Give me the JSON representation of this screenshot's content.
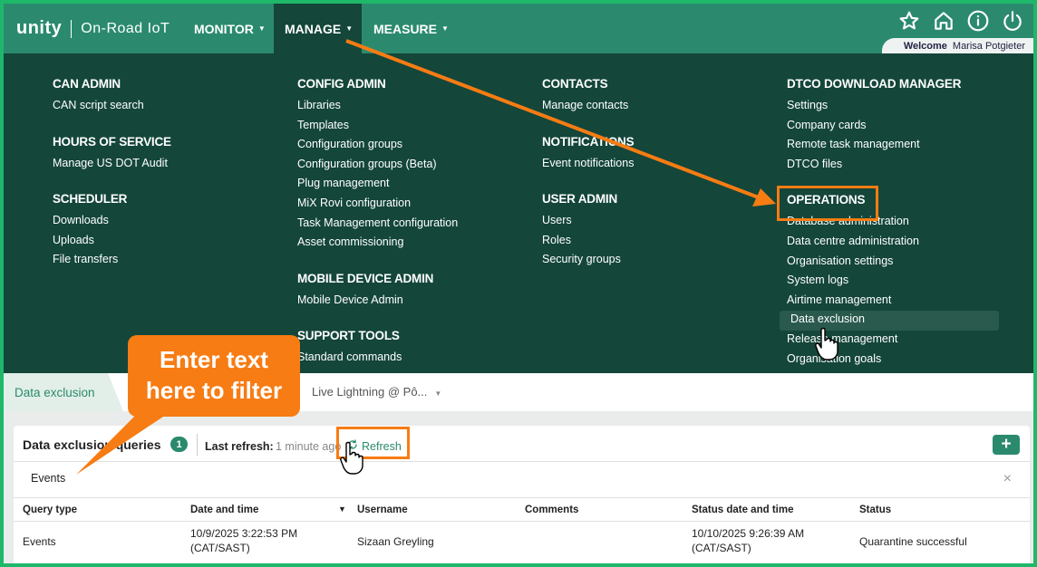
{
  "app": {
    "brand": "unity",
    "product": "On-Road IoT"
  },
  "nav": {
    "items": [
      {
        "label": "MONITOR"
      },
      {
        "label": "MANAGE"
      },
      {
        "label": "MEASURE"
      }
    ],
    "welcome_label": "Welcome",
    "user_name": "Marisa Potgieter",
    "icons": [
      "star-icon",
      "home-icon",
      "info-icon",
      "power-icon"
    ]
  },
  "menu": {
    "can_admin": {
      "title": "CAN ADMIN",
      "links": [
        "CAN script search"
      ]
    },
    "hours_of_service": {
      "title": "HOURS OF SERVICE",
      "links": [
        "Manage US DOT Audit"
      ]
    },
    "scheduler": {
      "title": "SCHEDULER",
      "links": [
        "Downloads",
        "Uploads",
        "File transfers"
      ]
    },
    "config_admin": {
      "title": "CONFIG ADMIN",
      "links": [
        "Libraries",
        "Templates",
        "Configuration groups",
        "Configuration groups (Beta)",
        "Plug management",
        "MiX Rovi configuration",
        "Task Management configuration",
        "Asset commissioning"
      ]
    },
    "mobile_device_admin": {
      "title": "MOBILE DEVICE ADMIN",
      "links": [
        "Mobile Device Admin"
      ]
    },
    "support_tools": {
      "title": "SUPPORT TOOLS",
      "links": [
        "Standard commands"
      ]
    },
    "contacts": {
      "title": "CONTACTS",
      "links": [
        "Manage contacts"
      ]
    },
    "notifications": {
      "title": "NOTIFICATIONS",
      "links": [
        "Event notifications"
      ]
    },
    "user_admin": {
      "title": "USER ADMIN",
      "links": [
        "Users",
        "Roles",
        "Security groups"
      ]
    },
    "dtco": {
      "title": "DTCO DOWNLOAD MANAGER",
      "links": [
        "Settings",
        "Company cards",
        "Remote task management",
        "DTCO files"
      ]
    },
    "operations": {
      "title": "OPERATIONS",
      "links": [
        "Database administration",
        "Data centre administration",
        "Organisation settings",
        "System logs",
        "Airtime management",
        "Data exclusion",
        "Release management",
        "Organisation goals"
      ]
    }
  },
  "page": {
    "tab_label": "Data exclusion",
    "context_value": "Live Lightning @ Pô..."
  },
  "card": {
    "title": "Data exclusion queries",
    "count": "1",
    "last_refresh_label": "Last refresh:",
    "last_refresh_value": "1 minute ago",
    "refresh_label": "Refresh",
    "add_label": "+",
    "filter_value": "Events",
    "clear_label": "×"
  },
  "table": {
    "headers": [
      "Query type",
      "Date and time",
      "Username",
      "Comments",
      "Status date and time",
      "Status"
    ],
    "rows": [
      {
        "query_type": "Events",
        "date_line1": "10/9/2025 3:22:53 PM",
        "date_line2": "(CAT/SAST)",
        "username": "Sizaan Greyling",
        "comments": "",
        "status_date_line1": "10/10/2025 9:26:39 AM",
        "status_date_line2": "(CAT/SAST)",
        "status": "Quarantine successful"
      }
    ]
  },
  "annotation": {
    "callout_text_line1": "Enter text",
    "callout_text_line2": "here to filter",
    "accent_color": "#f77c13"
  },
  "colors": {
    "primary": "#2b8a6e",
    "menu_bg": "#14463a",
    "frame": "#1fb86b"
  }
}
